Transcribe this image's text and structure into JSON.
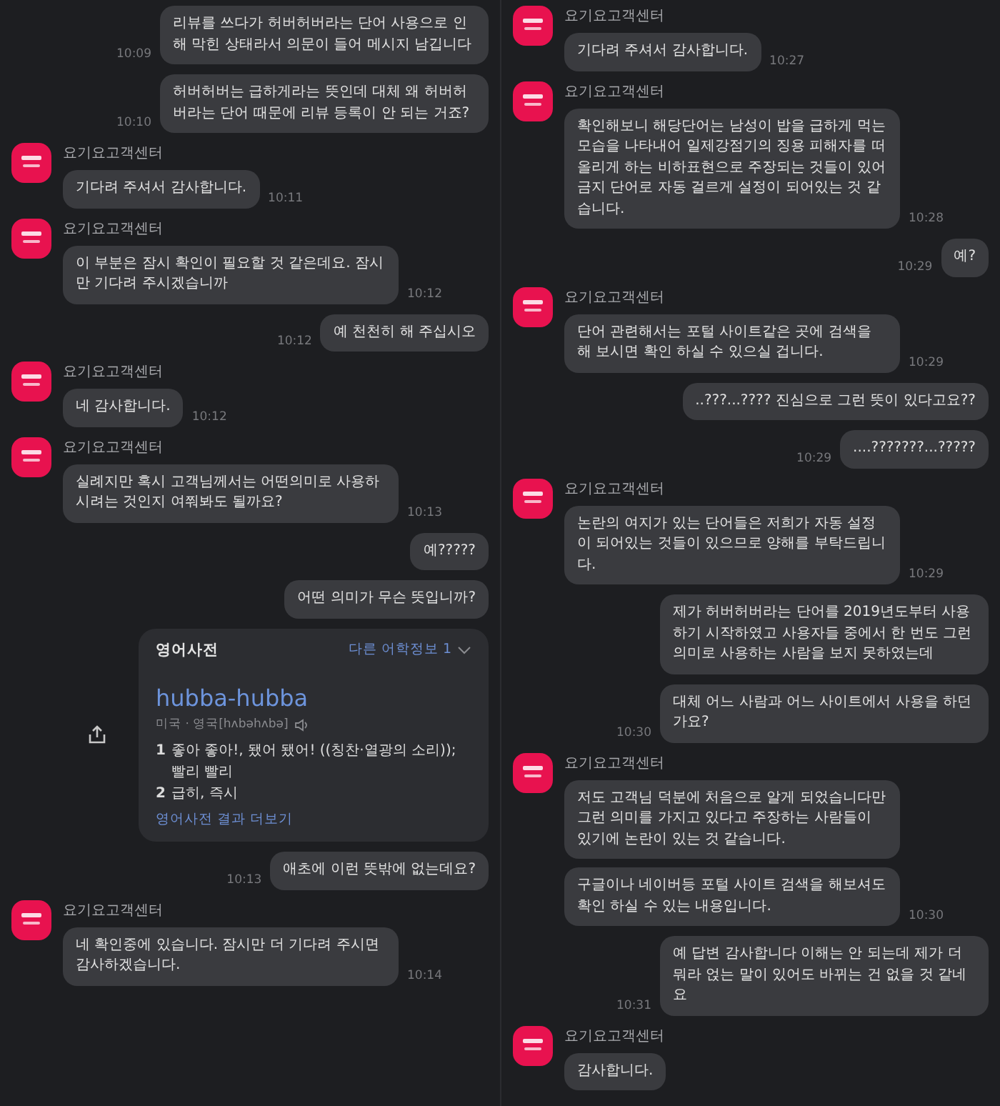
{
  "columns": [
    {
      "messages": [
        {
          "kind": "user",
          "text": "리뷰를 쓰다가 허버허버라는 단어 사용으로 인해 막힌 상태라서 의문이 들어 메시지 남깁니다",
          "time": "10:09"
        },
        {
          "kind": "user",
          "text": "허버허버는 급하게라는 뜻인데 대체 왜 허버허버라는 단어 때문에 리뷰 등록이 안 되는 거죠?",
          "time": "10:10"
        },
        {
          "kind": "agent",
          "sender": "요기요고객센터",
          "bubbles": [
            "기다려 주셔서 감사합니다."
          ],
          "time": "10:11"
        },
        {
          "kind": "agent",
          "sender": "요기요고객센터",
          "bubbles": [
            "이 부분은 잠시 확인이 필요할 것 같은데요. 잠시만 기다려 주시겠습니까"
          ],
          "time": "10:12"
        },
        {
          "kind": "user",
          "text": "예 천천히 해 주십시오",
          "time": "10:12"
        },
        {
          "kind": "agent",
          "sender": "요기요고객센터",
          "bubbles": [
            "네 감사합니다."
          ],
          "time": "10:12"
        },
        {
          "kind": "agent",
          "sender": "요기요고객센터",
          "bubbles": [
            "실례지만 혹시 고객님께서는 어떤의미로 사용하시려는 것인지 여쭤봐도 될까요?"
          ],
          "time": "10:13"
        },
        {
          "kind": "user",
          "text": "예?????"
        },
        {
          "kind": "user",
          "text": "어떤 의미가 무슨 뜻입니까?"
        },
        {
          "kind": "dict",
          "title": "영어사전",
          "other_link": "다른 어학정보 1",
          "word": "hubba-hubba",
          "pronunciation": "미국 · 영국[hʌbəhʌbə]",
          "definitions": [
            {
              "number": "1",
              "text": "좋아 좋아!, 됐어 됐어! ((칭찬·열광의 소리)); 빨리 빨리"
            },
            {
              "number": "2",
              "text": "급히, 즉시"
            }
          ],
          "more_link": "영어사전 결과 더보기"
        },
        {
          "kind": "user",
          "text": "애초에 이런 뜻밖에 없는데요?",
          "time": "10:13"
        },
        {
          "kind": "agent",
          "sender": "요기요고객센터",
          "bubbles": [
            "네 확인중에 있습니다. 잠시만 더 기다려 주시면 감사하겠습니다."
          ],
          "time": "10:14"
        }
      ]
    },
    {
      "messages": [
        {
          "kind": "agent",
          "sender": "요기요고객센터",
          "bubbles": [
            "기다려 주셔서 감사합니다."
          ],
          "time": "10:27"
        },
        {
          "kind": "agent",
          "sender": "요기요고객센터",
          "bubbles": [
            "확인해보니 해당단어는 남성이 밥을 급하게 먹는 모습을 나타내어 일제강점기의 징용 피해자를 떠올리게 하는 비하표현으로 주장되는 것들이 있어 금지 단어로 자동 걸르게 설정이 되어있는 것 같습니다."
          ],
          "time": "10:28"
        },
        {
          "kind": "user",
          "text": "예?",
          "time": "10:29"
        },
        {
          "kind": "agent",
          "sender": "요기요고객센터",
          "bubbles": [
            "단어 관련해서는 포털 사이트같은 곳에 검색을 해 보시면 확인 하실 수 있으실 겁니다."
          ],
          "time": "10:29"
        },
        {
          "kind": "user",
          "text": "..???...???? 진심으로 그런 뜻이 있다고요??"
        },
        {
          "kind": "user",
          "text": "....???????...?????",
          "time": "10:29"
        },
        {
          "kind": "agent",
          "sender": "요기요고객센터",
          "bubbles": [
            "논란의 여지가 있는 단어들은 저희가 자동 설정이 되어있는 것들이 있으므로 양해를 부탁드립니다."
          ],
          "time": "10:29"
        },
        {
          "kind": "user",
          "text": "제가 허버허버라는 단어를 2019년도부터 사용하기 시작하였고 사용자들 중에서 한 번도 그런 의미로 사용하는 사람을 보지 못하였는데"
        },
        {
          "kind": "user",
          "text": "대체 어느 사람과 어느 사이트에서 사용을 하던가요?",
          "time": "10:30"
        },
        {
          "kind": "agent",
          "sender": "요기요고객센터",
          "bubbles": [
            "저도 고객님 덕분에 처음으로 알게 되었습니다만 그런 의미를 가지고 있다고 주장하는 사람들이 있기에 논란이 있는 것 같습니다.",
            "구글이나 네이버등 포털 사이트 검색을 해보셔도 확인 하실 수 있는 내용입니다."
          ],
          "time": "10:30"
        },
        {
          "kind": "user",
          "text": "예 답변 감사합니다 이해는 안 되는데 제가 더 뭐라 얹는 말이 있어도 바뀌는 건 없을 것 같네요",
          "time": "10:31"
        },
        {
          "kind": "agent",
          "sender": "요기요고객센터",
          "bubbles": [
            "감사합니다."
          ]
        }
      ]
    }
  ]
}
